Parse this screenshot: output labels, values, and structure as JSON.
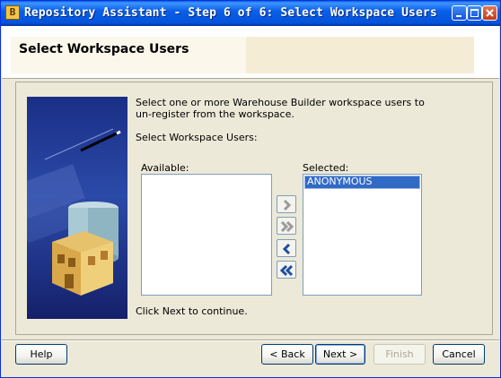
{
  "window": {
    "title": "Repository Assistant - Step 6 of 6: Select Workspace Users",
    "icon": "app-icon"
  },
  "header": {
    "title": "Select Workspace Users"
  },
  "content": {
    "instruction_line1": "Select one or more Warehouse Builder workspace users to",
    "instruction_line2": "un-register from the workspace.",
    "select_label": "Select Workspace Users:",
    "available_label": "Available:",
    "selected_label": "Selected:",
    "available_items": [],
    "selected_items": [
      "ANONYMOUS"
    ],
    "footer_note": "Click Next to continue."
  },
  "buttons": {
    "help": "Help",
    "back": "< Back",
    "next": "Next >",
    "finish": "Finish",
    "cancel": "Cancel"
  },
  "colors": {
    "titlebar": "#0a5fe8",
    "selection": "#316ac5",
    "move_arrow_disabled": "#9a9a9a",
    "move_arrow_enabled": "#1e4fa0"
  }
}
